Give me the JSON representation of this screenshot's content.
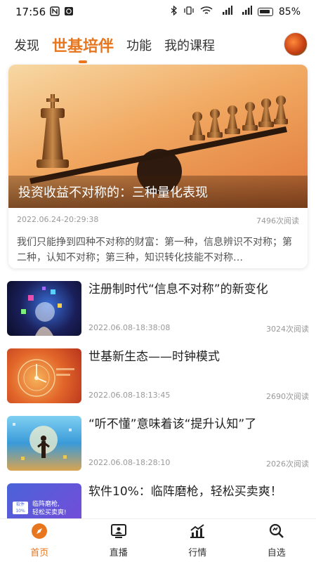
{
  "status_bar": {
    "time": "17:56",
    "battery": "85%"
  },
  "top_nav": {
    "tabs": [
      {
        "label": "发现"
      },
      {
        "label": "世基培伴"
      },
      {
        "label": "功能"
      },
      {
        "label": "我的课程"
      }
    ],
    "active_index": 1
  },
  "featured": {
    "caption": "投资收益不对称的：三种量化表现",
    "date": "2022.06.24-20:29:38",
    "reads": "7496次阅读",
    "summary": "我们只能挣到四种不对称的财富：第一种，信息辨识不对称；第二种，认知不对称；第三种，知识转化技能不对称…"
  },
  "articles": [
    {
      "title": "注册制时代“信息不对称”的新变化",
      "date": "2022.06.08-18:38:08",
      "reads": "3024次阅读"
    },
    {
      "title": "世基新生态——时钟模式",
      "date": "2022.06.08-18:13:45",
      "reads": "2690次阅读"
    },
    {
      "title": "“听不懂”意味着该“提升认知”了",
      "date": "2022.06.08-18:28:10",
      "reads": "2026次阅读"
    },
    {
      "title": "软件10%：临阵磨枪，轻松买卖爽！",
      "date": "",
      "reads": ""
    }
  ],
  "thumb_texts": {
    "article4_badge": "软件10%",
    "article4_line1": "临阵磨枪,",
    "article4_line2": "轻松买卖爽!"
  },
  "bottom_tabs": [
    {
      "label": "首页",
      "icon": "compass-icon"
    },
    {
      "label": "直播",
      "icon": "live-icon"
    },
    {
      "label": "行情",
      "icon": "chart-icon"
    },
    {
      "label": "自选",
      "icon": "search-doc-icon"
    }
  ],
  "colors": {
    "accent": "#e8761e"
  }
}
